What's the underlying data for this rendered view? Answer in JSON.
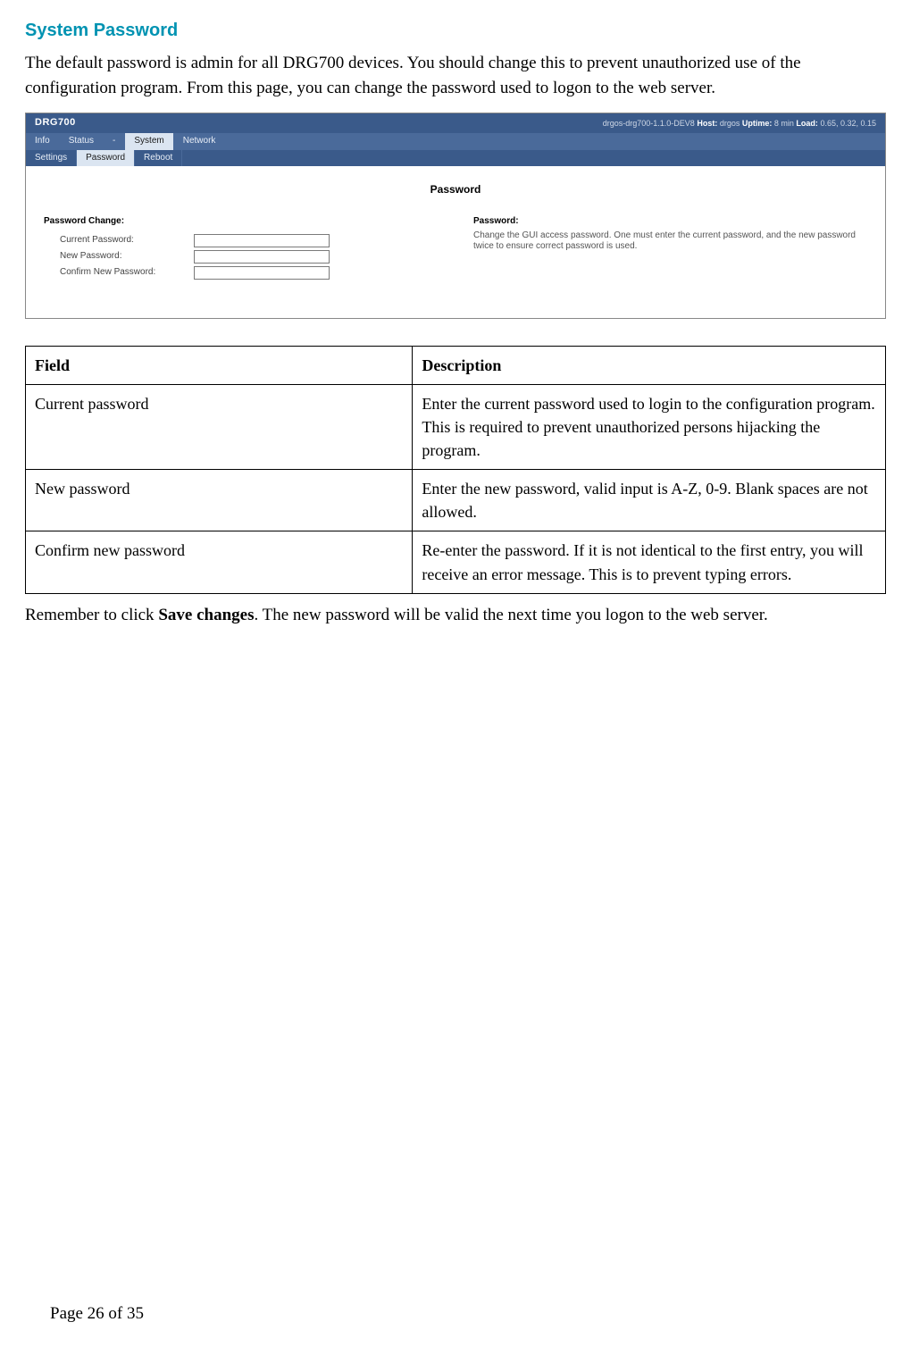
{
  "section_title": "System Password",
  "intro_text": "The default password is admin for all DRG700 devices. You should change this to prevent unauthorized use of the configuration program. From this page, you can change the password used to logon to the web server.",
  "ui": {
    "brand": "DRG700",
    "meta_firmware": "drgos-drg700-1.1.0-DEV8",
    "meta_host_label": "Host:",
    "meta_host_value": "drgos",
    "meta_uptime_label": "Uptime:",
    "meta_uptime_value": "8 min",
    "meta_load_label": "Load:",
    "meta_load_value": "0.65, 0.32, 0.15",
    "nav1": [
      "Info",
      "Status",
      "-",
      "System",
      "Network"
    ],
    "nav1_active_index": 3,
    "nav2": [
      "Settings",
      "Password",
      "Reboot"
    ],
    "nav2_active_index": 1,
    "page_title": "Password",
    "legend": "Password Change:",
    "field1": "Current Password:",
    "field2": "New Password:",
    "field3": "Confirm New Password:",
    "help_head": "Password:",
    "help_text": "Change the GUI access password. One must enter the current password, and the new password twice to ensure correct password is used."
  },
  "table": {
    "head_field": "Field",
    "head_desc": "Description",
    "rows": [
      {
        "field": "Current password",
        "desc": "Enter the current password used to login to the configuration program. This is required to prevent unauthorized persons hijacking the program."
      },
      {
        "field": "New password",
        "desc": "Enter the new password, valid input is A-Z, 0-9. Blank spaces are not allowed."
      },
      {
        "field": "Confirm new password",
        "desc": "Re-enter the password. If it is not identical to the first entry, you will receive an error message. This is to prevent typing errors."
      }
    ]
  },
  "outro_prefix": "Remember to click ",
  "outro_bold": "Save changes",
  "outro_suffix": ". The new password will be valid the next time you logon to the web server.",
  "footer": "Page 26 of 35"
}
